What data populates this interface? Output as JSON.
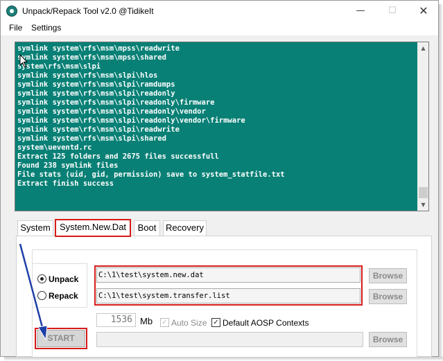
{
  "window": {
    "title": "Unpack/Repack Tool  v2.0  @TidikeIt",
    "minimize_glyph": "—",
    "maximize_glyph": "☐",
    "close_glyph": "✕"
  },
  "menu": {
    "items": [
      "File",
      "Settings"
    ]
  },
  "log": {
    "lines": [
      "symlink system\\rfs\\msm\\mpss\\readwrite",
      "symlink system\\rfs\\msm\\mpss\\shared",
      "system\\rfs\\msm\\slpi",
      "symlink system\\rfs\\msm\\slpi\\hlos",
      "symlink system\\rfs\\msm\\slpi\\ramdumps",
      "symlink system\\rfs\\msm\\slpi\\readonly",
      "symlink system\\rfs\\msm\\slpi\\readonly\\firmware",
      "symlink system\\rfs\\msm\\slpi\\readonly\\vendor",
      "symlink system\\rfs\\msm\\slpi\\readonly\\vendor\\firmware",
      "symlink system\\rfs\\msm\\slpi\\readwrite",
      "symlink system\\rfs\\msm\\slpi\\shared",
      "system\\ueventd.rc",
      "Extract 125 folders and 2675 files successfull",
      "Found 238 symlink files",
      "File stats (uid, gid, permission) save to system_statfile.txt",
      "Extract finish success"
    ],
    "background_color": "#098076"
  },
  "tabs": [
    {
      "label": "System",
      "selected": false
    },
    {
      "label": "System.New.Dat",
      "selected": true
    },
    {
      "label": "Boot",
      "selected": false
    },
    {
      "label": "Recovery",
      "selected": false
    }
  ],
  "panel": {
    "mode_unpack_label": "Unpack",
    "mode_repack_label": "Repack",
    "mode_selected": "Unpack",
    "new_dat_path": "C:\\1\\test\\system.new.dat",
    "transfer_list_path": "C:\\1\\test\\system.transfer.list",
    "browse_label": "Browse",
    "size_value": "1536",
    "size_unit": "Mb",
    "auto_size_label": "Auto Size",
    "auto_size_checked": true,
    "aosp_contexts_label": "Default AOSP Contexts",
    "aosp_contexts_checked": true,
    "start_label": "START",
    "check_glyph": "✓",
    "output_path": ""
  },
  "annotation_color": "#d61a1a"
}
